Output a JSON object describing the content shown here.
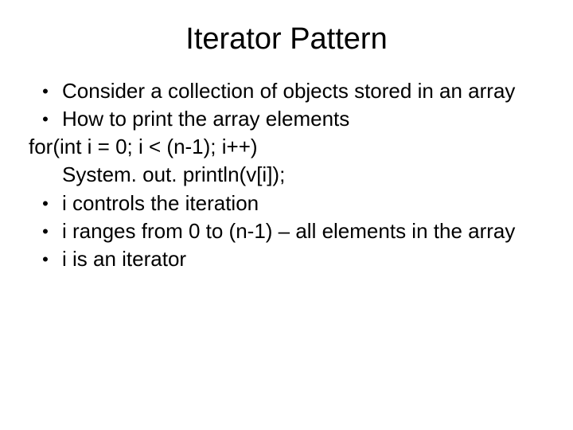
{
  "title": "Iterator Pattern",
  "lines": {
    "l1": "Consider a collection of objects stored in an array",
    "l2": "How to print the array elements",
    "l3": "for(int i = 0; i < (n-1); i++)",
    "l4": "System. out. println(v[i]);",
    "l5": "i controls the iteration",
    "l6": "i ranges from 0 to (n-1) – all elements in the array",
    "l7": "i is an iterator"
  }
}
